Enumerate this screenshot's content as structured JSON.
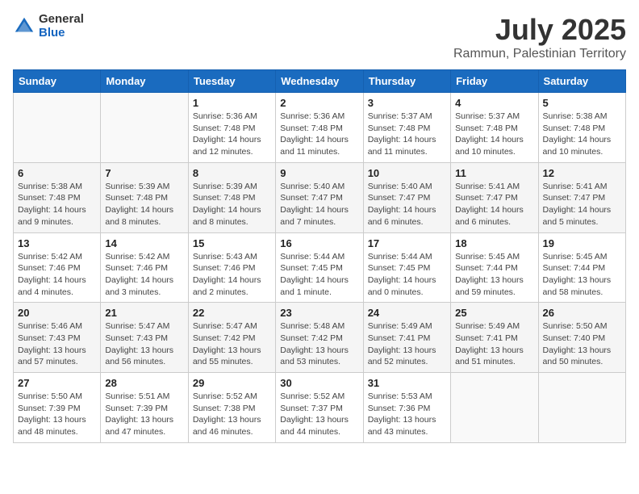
{
  "header": {
    "logo_general": "General",
    "logo_blue": "Blue",
    "month": "July 2025",
    "location": "Rammun, Palestinian Territory"
  },
  "weekdays": [
    "Sunday",
    "Monday",
    "Tuesday",
    "Wednesday",
    "Thursday",
    "Friday",
    "Saturday"
  ],
  "weeks": [
    [
      {
        "day": null
      },
      {
        "day": null
      },
      {
        "day": "1",
        "sunrise": "Sunrise: 5:36 AM",
        "sunset": "Sunset: 7:48 PM",
        "daylight": "Daylight: 14 hours and 12 minutes."
      },
      {
        "day": "2",
        "sunrise": "Sunrise: 5:36 AM",
        "sunset": "Sunset: 7:48 PM",
        "daylight": "Daylight: 14 hours and 11 minutes."
      },
      {
        "day": "3",
        "sunrise": "Sunrise: 5:37 AM",
        "sunset": "Sunset: 7:48 PM",
        "daylight": "Daylight: 14 hours and 11 minutes."
      },
      {
        "day": "4",
        "sunrise": "Sunrise: 5:37 AM",
        "sunset": "Sunset: 7:48 PM",
        "daylight": "Daylight: 14 hours and 10 minutes."
      },
      {
        "day": "5",
        "sunrise": "Sunrise: 5:38 AM",
        "sunset": "Sunset: 7:48 PM",
        "daylight": "Daylight: 14 hours and 10 minutes."
      }
    ],
    [
      {
        "day": "6",
        "sunrise": "Sunrise: 5:38 AM",
        "sunset": "Sunset: 7:48 PM",
        "daylight": "Daylight: 14 hours and 9 minutes."
      },
      {
        "day": "7",
        "sunrise": "Sunrise: 5:39 AM",
        "sunset": "Sunset: 7:48 PM",
        "daylight": "Daylight: 14 hours and 8 minutes."
      },
      {
        "day": "8",
        "sunrise": "Sunrise: 5:39 AM",
        "sunset": "Sunset: 7:48 PM",
        "daylight": "Daylight: 14 hours and 8 minutes."
      },
      {
        "day": "9",
        "sunrise": "Sunrise: 5:40 AM",
        "sunset": "Sunset: 7:47 PM",
        "daylight": "Daylight: 14 hours and 7 minutes."
      },
      {
        "day": "10",
        "sunrise": "Sunrise: 5:40 AM",
        "sunset": "Sunset: 7:47 PM",
        "daylight": "Daylight: 14 hours and 6 minutes."
      },
      {
        "day": "11",
        "sunrise": "Sunrise: 5:41 AM",
        "sunset": "Sunset: 7:47 PM",
        "daylight": "Daylight: 14 hours and 6 minutes."
      },
      {
        "day": "12",
        "sunrise": "Sunrise: 5:41 AM",
        "sunset": "Sunset: 7:47 PM",
        "daylight": "Daylight: 14 hours and 5 minutes."
      }
    ],
    [
      {
        "day": "13",
        "sunrise": "Sunrise: 5:42 AM",
        "sunset": "Sunset: 7:46 PM",
        "daylight": "Daylight: 14 hours and 4 minutes."
      },
      {
        "day": "14",
        "sunrise": "Sunrise: 5:42 AM",
        "sunset": "Sunset: 7:46 PM",
        "daylight": "Daylight: 14 hours and 3 minutes."
      },
      {
        "day": "15",
        "sunrise": "Sunrise: 5:43 AM",
        "sunset": "Sunset: 7:46 PM",
        "daylight": "Daylight: 14 hours and 2 minutes."
      },
      {
        "day": "16",
        "sunrise": "Sunrise: 5:44 AM",
        "sunset": "Sunset: 7:45 PM",
        "daylight": "Daylight: 14 hours and 1 minute."
      },
      {
        "day": "17",
        "sunrise": "Sunrise: 5:44 AM",
        "sunset": "Sunset: 7:45 PM",
        "daylight": "Daylight: 14 hours and 0 minutes."
      },
      {
        "day": "18",
        "sunrise": "Sunrise: 5:45 AM",
        "sunset": "Sunset: 7:44 PM",
        "daylight": "Daylight: 13 hours and 59 minutes."
      },
      {
        "day": "19",
        "sunrise": "Sunrise: 5:45 AM",
        "sunset": "Sunset: 7:44 PM",
        "daylight": "Daylight: 13 hours and 58 minutes."
      }
    ],
    [
      {
        "day": "20",
        "sunrise": "Sunrise: 5:46 AM",
        "sunset": "Sunset: 7:43 PM",
        "daylight": "Daylight: 13 hours and 57 minutes."
      },
      {
        "day": "21",
        "sunrise": "Sunrise: 5:47 AM",
        "sunset": "Sunset: 7:43 PM",
        "daylight": "Daylight: 13 hours and 56 minutes."
      },
      {
        "day": "22",
        "sunrise": "Sunrise: 5:47 AM",
        "sunset": "Sunset: 7:42 PM",
        "daylight": "Daylight: 13 hours and 55 minutes."
      },
      {
        "day": "23",
        "sunrise": "Sunrise: 5:48 AM",
        "sunset": "Sunset: 7:42 PM",
        "daylight": "Daylight: 13 hours and 53 minutes."
      },
      {
        "day": "24",
        "sunrise": "Sunrise: 5:49 AM",
        "sunset": "Sunset: 7:41 PM",
        "daylight": "Daylight: 13 hours and 52 minutes."
      },
      {
        "day": "25",
        "sunrise": "Sunrise: 5:49 AM",
        "sunset": "Sunset: 7:41 PM",
        "daylight": "Daylight: 13 hours and 51 minutes."
      },
      {
        "day": "26",
        "sunrise": "Sunrise: 5:50 AM",
        "sunset": "Sunset: 7:40 PM",
        "daylight": "Daylight: 13 hours and 50 minutes."
      }
    ],
    [
      {
        "day": "27",
        "sunrise": "Sunrise: 5:50 AM",
        "sunset": "Sunset: 7:39 PM",
        "daylight": "Daylight: 13 hours and 48 minutes."
      },
      {
        "day": "28",
        "sunrise": "Sunrise: 5:51 AM",
        "sunset": "Sunset: 7:39 PM",
        "daylight": "Daylight: 13 hours and 47 minutes."
      },
      {
        "day": "29",
        "sunrise": "Sunrise: 5:52 AM",
        "sunset": "Sunset: 7:38 PM",
        "daylight": "Daylight: 13 hours and 46 minutes."
      },
      {
        "day": "30",
        "sunrise": "Sunrise: 5:52 AM",
        "sunset": "Sunset: 7:37 PM",
        "daylight": "Daylight: 13 hours and 44 minutes."
      },
      {
        "day": "31",
        "sunrise": "Sunrise: 5:53 AM",
        "sunset": "Sunset: 7:36 PM",
        "daylight": "Daylight: 13 hours and 43 minutes."
      },
      {
        "day": null
      },
      {
        "day": null
      }
    ]
  ]
}
